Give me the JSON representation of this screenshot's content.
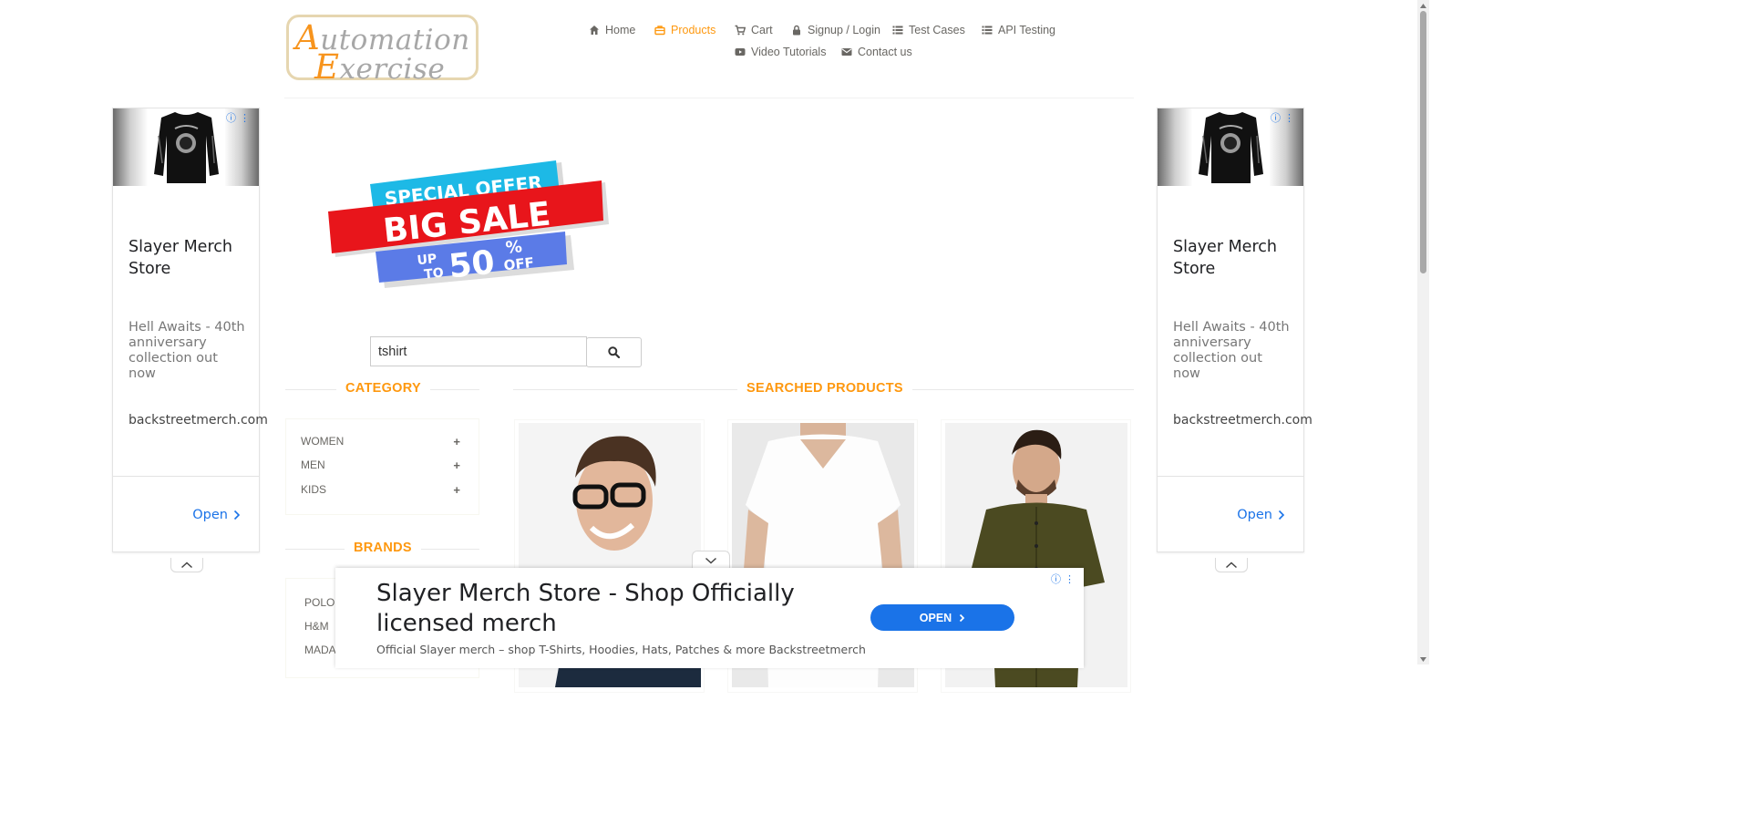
{
  "logo": {
    "row1_cap": "A",
    "row1_rest": "utomation",
    "row2_cap": "E",
    "row2_rest": "xercise"
  },
  "nav": {
    "items": [
      {
        "label": "Home",
        "icon": "home-icon"
      },
      {
        "label": "Products",
        "icon": "products-icon",
        "active": true
      },
      {
        "label": "Cart",
        "icon": "cart-icon"
      },
      {
        "label": "Signup / Login",
        "icon": "lock-icon"
      },
      {
        "label": "Test Cases",
        "icon": "list-icon"
      },
      {
        "label": "API Testing",
        "icon": "list-icon"
      },
      {
        "label": "Video Tutorials",
        "icon": "youtube-icon"
      },
      {
        "label": "Contact us",
        "icon": "envelope-icon"
      }
    ],
    "active_color": "#fe980f"
  },
  "side_ad": {
    "title": "Slayer Merch Store",
    "body": "Hell Awaits - 40th anniversary collection out now",
    "url": "backstreetmerch.com",
    "open_label": "Open"
  },
  "banner": {
    "line1": "SPECIAL OFFER",
    "line2": "BIG SALE",
    "up": "UP",
    "to": "TO",
    "pct": "50",
    "pct_sign": "%",
    "off": "OFF"
  },
  "search": {
    "value": "tshirt"
  },
  "category": {
    "title": "CATEGORY",
    "items": [
      {
        "label": "WOMEN"
      },
      {
        "label": "MEN"
      },
      {
        "label": "KIDS"
      }
    ],
    "expand_glyph": "+"
  },
  "brands": {
    "title": "BRANDS",
    "items": [
      {
        "label": "POLO"
      },
      {
        "label": "H&M"
      },
      {
        "label": "MADAME"
      }
    ]
  },
  "products": {
    "title": "SEARCHED PRODUCTS"
  },
  "bottom_ad": {
    "title": "Slayer Merch Store - Shop Officially licensed merch",
    "body": "Official Slayer merch – shop T-Shirts, Hoodies, Hats, Patches & more Backstreetmerch",
    "open_label": "OPEN"
  },
  "colors": {
    "accent": "#fe980f",
    "ad_blue": "#1a73e8",
    "text": "#696763"
  }
}
